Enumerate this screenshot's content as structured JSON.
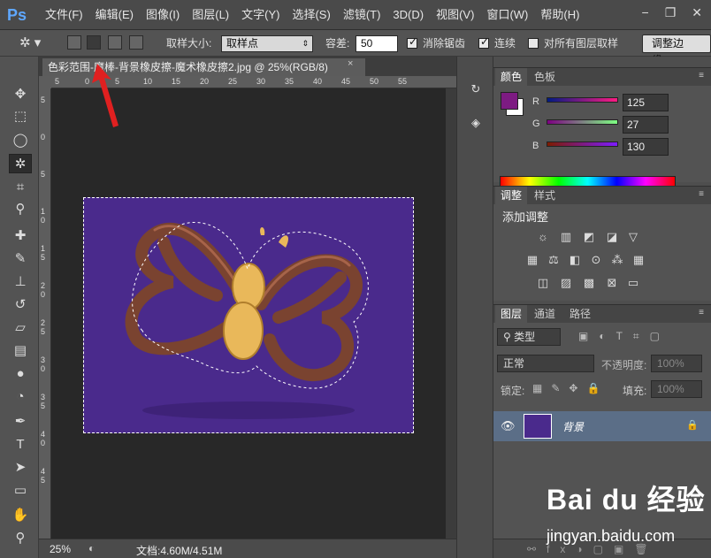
{
  "app": {
    "logo": "Ps"
  },
  "menu": [
    "文件(F)",
    "编辑(E)",
    "图像(I)",
    "图层(L)",
    "文字(Y)",
    "选择(S)",
    "滤镜(T)",
    "3D(D)",
    "视图(V)",
    "窗口(W)",
    "帮助(H)"
  ],
  "window_controls": {
    "minimize": "−",
    "restore": "❐",
    "close": "✕"
  },
  "options": {
    "sample_size_label": "取样大小:",
    "sample_size_value": "取样点",
    "tolerance_label": "容差:",
    "tolerance_value": "50",
    "antialias_label": "消除锯齿",
    "antialias_checked": true,
    "contiguous_label": "连续",
    "contiguous_checked": true,
    "sample_all_label": "对所有图层取样",
    "sample_all_checked": false,
    "refine_edge_label": "调整边缘..."
  },
  "document": {
    "tab_title": "色彩范围-魔棒-背景橡皮擦-魔术橡皮擦2.jpg @ 25%(RGB/8)",
    "close": "×",
    "ruler_h": [
      "5",
      "0",
      "5",
      "10",
      "15",
      "20",
      "25",
      "30",
      "35",
      "40",
      "45",
      "50",
      "55"
    ],
    "ruler_v": [
      "5",
      "0",
      "5",
      "1 0",
      "1 5",
      "2 0",
      "2 5",
      "3 0",
      "3 5",
      "4 0",
      "4 5"
    ],
    "zoom": "25%",
    "doc_size": "文档:4.60M/4.51M"
  },
  "tools": [
    {
      "name": "move-tool-icon",
      "glyph": "✥"
    },
    {
      "name": "marquee-tool-icon",
      "glyph": "⬚"
    },
    {
      "name": "lasso-tool-icon",
      "glyph": "◯"
    },
    {
      "name": "magic-wand-tool-icon",
      "glyph": "✲"
    },
    {
      "name": "crop-tool-icon",
      "glyph": "⌗"
    },
    {
      "name": "eyedropper-tool-icon",
      "glyph": "⚲"
    },
    {
      "name": "healing-tool-icon",
      "glyph": "✚"
    },
    {
      "name": "brush-tool-icon",
      "glyph": "✎"
    },
    {
      "name": "clone-stamp-tool-icon",
      "glyph": "⊥"
    },
    {
      "name": "history-brush-tool-icon",
      "glyph": "↺"
    },
    {
      "name": "eraser-tool-icon",
      "glyph": "▱"
    },
    {
      "name": "gradient-tool-icon",
      "glyph": "▤"
    },
    {
      "name": "blur-tool-icon",
      "glyph": "●"
    },
    {
      "name": "dodge-tool-icon",
      "glyph": "◔"
    },
    {
      "name": "pen-tool-icon",
      "glyph": "✒"
    },
    {
      "name": "type-tool-icon",
      "glyph": "T"
    },
    {
      "name": "path-select-tool-icon",
      "glyph": "➤"
    },
    {
      "name": "shape-tool-icon",
      "glyph": "▭"
    },
    {
      "name": "hand-tool-icon",
      "glyph": "✋"
    },
    {
      "name": "zoom-tool-icon",
      "glyph": "⚲"
    }
  ],
  "color_panel": {
    "tabs": [
      "颜色",
      "色板"
    ],
    "fg_color": "#7d1b82",
    "r_label": "R",
    "r_value": "125",
    "g_label": "G",
    "g_value": "27",
    "b_label": "B",
    "b_value": "130"
  },
  "adjust_panel": {
    "tabs": [
      "调整",
      "样式"
    ],
    "title": "添加调整"
  },
  "layers_panel": {
    "tabs": [
      "图层",
      "通道",
      "路径"
    ],
    "kind_filter": "类型",
    "blend_mode": "正常",
    "opacity_label": "不透明度:",
    "opacity_value": "100%",
    "lock_label": "锁定:",
    "fill_label": "填充:",
    "fill_value": "100%",
    "layer_name": "背景"
  },
  "watermark": {
    "brand": "Bai du 经验",
    "url": "jingyan.baidu.com"
  }
}
